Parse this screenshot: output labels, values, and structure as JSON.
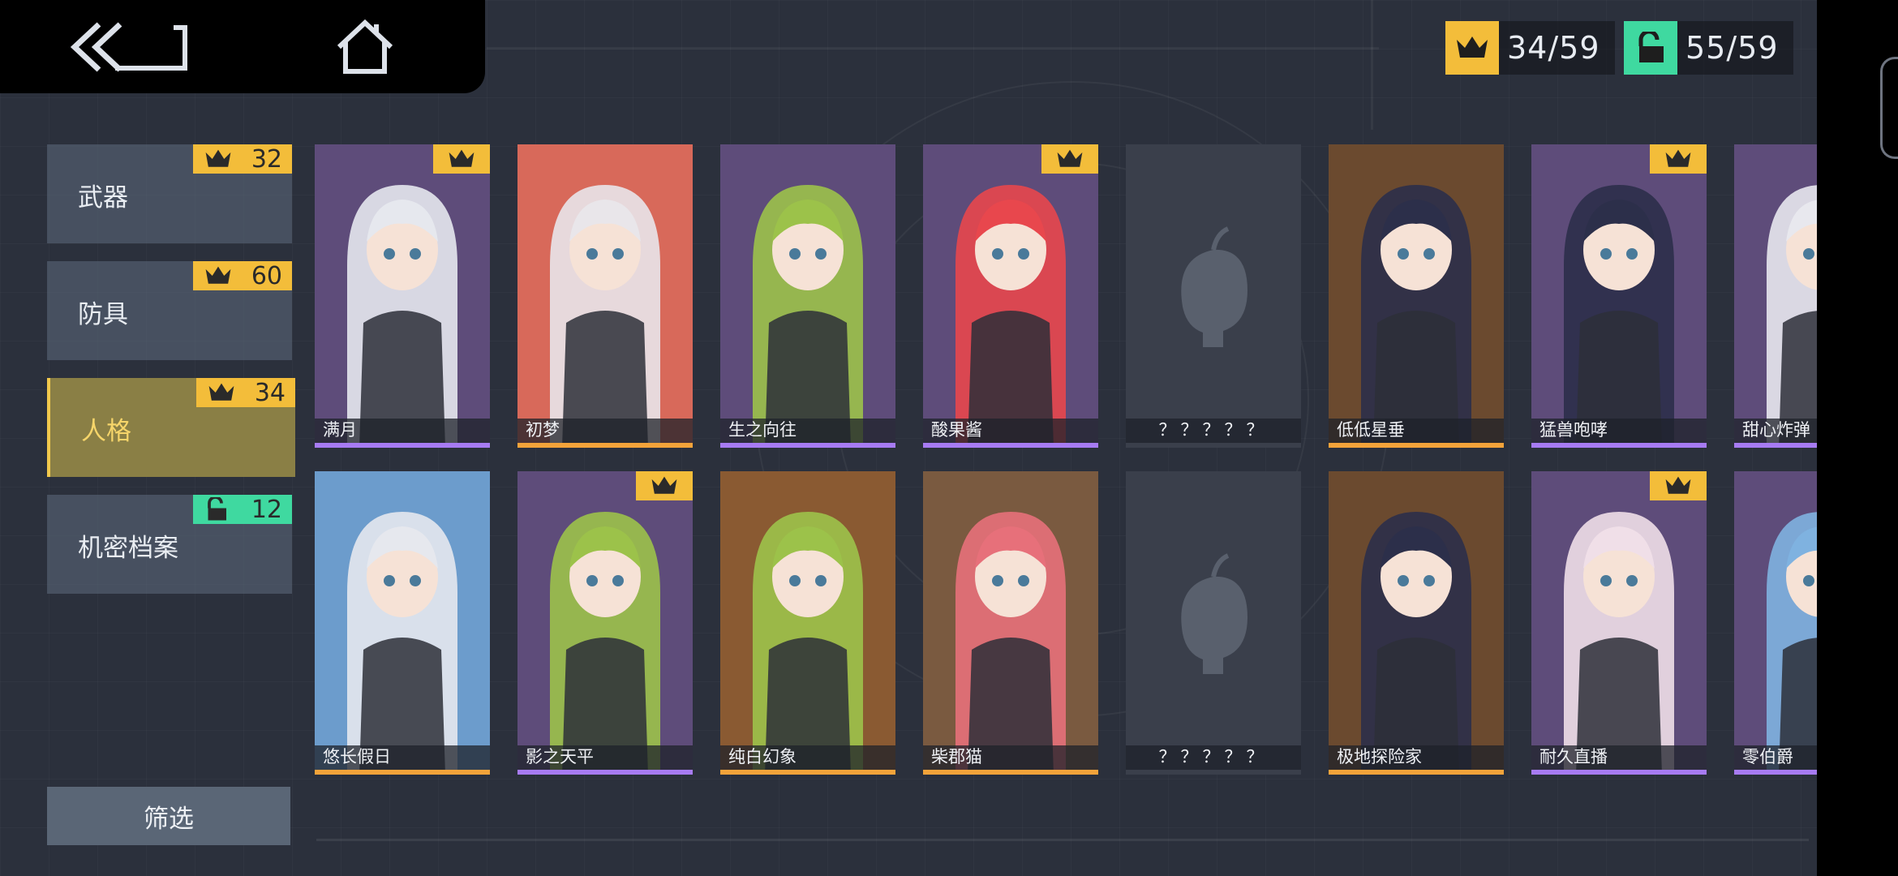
{
  "counters": {
    "crown": {
      "icon": "crown-icon",
      "text": "34/59",
      "color": "#f3bd3a"
    },
    "unlock": {
      "icon": "unlock-icon",
      "text": "55/59",
      "color": "#3fd9a0"
    }
  },
  "sidebar": {
    "categories": [
      {
        "label": "武器",
        "badge_icon": "crown-icon",
        "badge_value": "32",
        "active": false
      },
      {
        "label": "防具",
        "badge_icon": "crown-icon",
        "badge_value": "60",
        "active": false
      },
      {
        "label": "人格",
        "badge_icon": "crown-icon",
        "badge_value": "34",
        "active": true
      },
      {
        "label": "机密档案",
        "badge_icon": "unlock-icon",
        "badge_value": "12",
        "active": false
      }
    ],
    "filter_label": "筛选"
  },
  "cards": [
    {
      "name": "满月",
      "crown": true,
      "underline": "#a77bf3",
      "bg": "#5e4c7a",
      "hair": "#e6e8ee",
      "locked": false
    },
    {
      "name": "初梦",
      "crown": false,
      "underline": "#f3a33a",
      "bg": "#d8695a",
      "hair": "#e9e6ea",
      "locked": false
    },
    {
      "name": "生之向往",
      "crown": false,
      "underline": "#a77bf3",
      "bg": "#5e4c7a",
      "hair": "#9cc24a",
      "locked": false
    },
    {
      "name": "酸果酱",
      "crown": true,
      "underline": "#a77bf3",
      "bg": "#5e4c7a",
      "hair": "#e8474d",
      "locked": false
    },
    {
      "name": "？？？？？",
      "crown": false,
      "underline": "#3a3f4b",
      "bg": "#3a3f4b",
      "hair": "#3a3f4b",
      "locked": true
    },
    {
      "name": "低低星垂",
      "crown": false,
      "underline": "#f3a33a",
      "bg": "#6b4a2f",
      "hair": "#2c2f4a",
      "locked": false
    },
    {
      "name": "猛兽咆哮",
      "crown": true,
      "underline": "#a77bf3",
      "bg": "#5e4c7a",
      "hair": "#2c2f4a",
      "locked": false
    },
    {
      "name": "甜心炸弹",
      "crown": false,
      "underline": "#a77bf3",
      "bg": "#5e4c7a",
      "hair": "#e8e8ee",
      "locked": false
    },
    {
      "name": "悠长假日",
      "crown": false,
      "underline": "#f3a33a",
      "bg": "#6c9ccc",
      "hair": "#e6e8ee",
      "locked": false
    },
    {
      "name": "影之天平",
      "crown": true,
      "underline": "#a77bf3",
      "bg": "#5e4c7a",
      "hair": "#9cc24a",
      "locked": false
    },
    {
      "name": "纯白幻象",
      "crown": false,
      "underline": "#f3a33a",
      "bg": "#8a5a32",
      "hair": "#9cc24a",
      "locked": false
    },
    {
      "name": "柴郡猫",
      "crown": false,
      "underline": "#f3a33a",
      "bg": "#7a5a40",
      "hair": "#e7707a",
      "locked": false
    },
    {
      "name": "？？？？？",
      "crown": false,
      "underline": "#3a3f4b",
      "bg": "#3a3f4b",
      "hair": "#3a3f4b",
      "locked": true
    },
    {
      "name": "极地探险家",
      "crown": false,
      "underline": "#f3a33a",
      "bg": "#6b4a2f",
      "hair": "#2c2f4a",
      "locked": false
    },
    {
      "name": "耐久直播",
      "crown": true,
      "underline": "#a77bf3",
      "bg": "#5e4c7a",
      "hair": "#f0dfe8",
      "locked": false
    },
    {
      "name": "零伯爵",
      "crown": false,
      "underline": "#a77bf3",
      "bg": "#5e4c7a",
      "hair": "#7fb2e0",
      "locked": false
    }
  ]
}
